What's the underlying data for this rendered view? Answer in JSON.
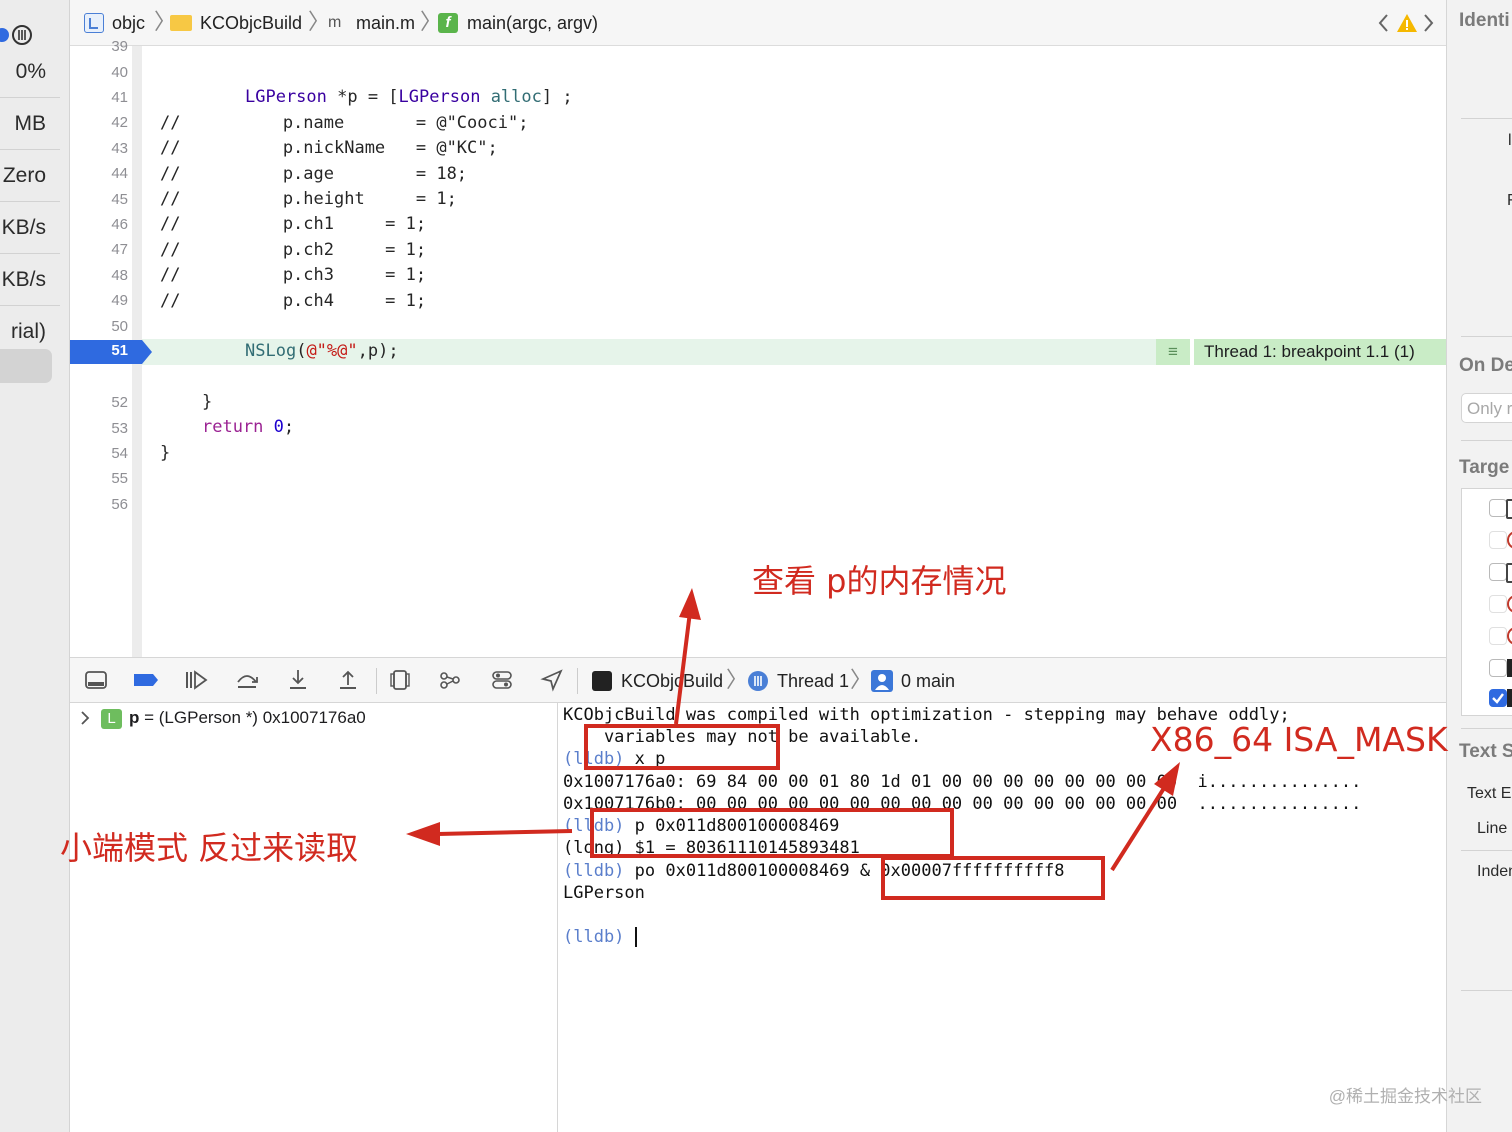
{
  "left_sidebar": {
    "gauges": [
      "0%",
      "MB",
      "Zero",
      "KB/s",
      "KB/s",
      "rial)"
    ]
  },
  "jump_bar": {
    "crumbs": [
      "objc",
      "KCObjcBuild",
      "main.m",
      "main(argc, argv)"
    ],
    "file_glyph": "m",
    "func_glyph": "f"
  },
  "editor": {
    "line_numbers": [
      "39",
      "40",
      "41",
      "42",
      "43",
      "44",
      "45",
      "46",
      "47",
      "48",
      "49",
      "50",
      "51",
      "52",
      "53",
      "54",
      "55",
      "56"
    ],
    "line41": {
      "cls": "LGPerson",
      "mid": " *p = [",
      "cls2": "LGPerson",
      "sp": " ",
      "msg": "alloc",
      "end": "] ;"
    },
    "comment_lines": [
      "//          p.name       = @\"Cooci\";",
      "//          p.nickName   = @\"KC\";",
      "//          p.age        = 18;",
      "//          p.height     = 1;",
      "//          p.ch1     = 1;",
      "//          p.ch2     = 1;",
      "//          p.ch3     = 1;",
      "//          p.ch4     = 1;"
    ],
    "line51": {
      "fn": "NSLog",
      "open": "(",
      "str": "@\"%@\"",
      "rest": ",p);"
    },
    "line53": "}",
    "line54": {
      "kw": "return",
      "sp": " ",
      "num": "0",
      "end": ";"
    },
    "line55": "}",
    "breakpoint_label": "Thread 1: breakpoint 1.1 (1)"
  },
  "annotations": {
    "memory": "查看 p的内存情况",
    "little_endian": "小端模式 反过来读取",
    "isa_mask": "X86_64  ISA_MASK"
  },
  "debug_bar": {
    "crumbs": [
      "KCObjcBuild",
      "Thread 1",
      "0 main"
    ]
  },
  "variables": {
    "badge": "L",
    "name": "p",
    "value": " = (LGPerson *) 0x1007176a0"
  },
  "console": {
    "lines": [
      {
        "text": "KCObjcBuild was compiled with optimization - stepping may behave oddly;"
      },
      {
        "text": "    variables may not be available."
      },
      {
        "prompt": "(lldb)",
        "text": " x p"
      },
      {
        "text": "0x1007176a0: 69 84 00 00 01 80 1d 01 00 00 00 00 00 00 00 00  i..............."
      },
      {
        "text": "0x1007176b0: 00 00 00 00 00 00 00 00 00 00 00 00 00 00 00 00  ................"
      },
      {
        "prompt": "(lldb)",
        "text": " p 0x011d800100008469"
      },
      {
        "text": "(long) $1 = 80361110145893481"
      },
      {
        "prompt": "(lldb)",
        "text": " po 0x011d800100008469 & 0x00007ffffffffff8"
      },
      {
        "text": "LGPerson"
      },
      {
        "prompt": "(lldb)",
        "text": " "
      }
    ]
  },
  "inspector": {
    "identity": "Identi",
    "l1": "l",
    "l2": "F",
    "on_demand": "On De",
    "only": "Only r",
    "target": "Targe",
    "checkbox_checked": [
      false,
      false,
      false,
      false,
      false,
      false,
      true
    ],
    "text_settings": "Text S",
    "text_encoding": "Text E",
    "line": "Line",
    "indent": "Inden"
  },
  "watermark": "@稀土掘金技术社区",
  "colors": {
    "annotation_red": "#d12a1f",
    "breakpoint_blue": "#2f6ae0",
    "breakpoint_line": "#e6f4ea",
    "lldb_prompt": "#5a7ecb"
  }
}
